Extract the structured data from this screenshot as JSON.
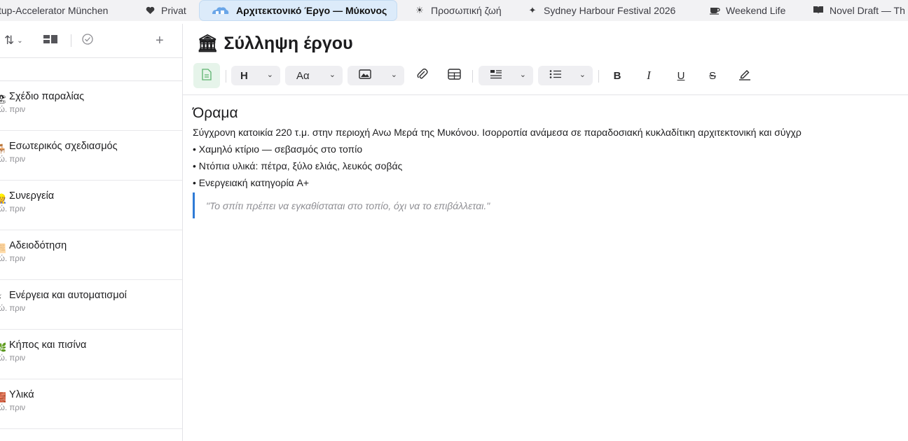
{
  "tabs": [
    {
      "icon": "",
      "label": "tup-Accelerator München",
      "active": false
    },
    {
      "icon": "heart-icon",
      "label": "Privat",
      "active": false
    },
    {
      "icon": "cloud-houses-icon",
      "label": "Αρχιτεκτονικό Έργο — Μύκονος",
      "active": true
    },
    {
      "icon": "sun-icon",
      "label": "Προσωπική ζωή",
      "active": false
    },
    {
      "icon": "sparkles-icon",
      "label": "Sydney Harbour Festival 2026",
      "active": false
    },
    {
      "icon": "coffee-icon",
      "label": "Weekend Life",
      "active": false
    },
    {
      "icon": "book-icon",
      "label": "Novel Draft — Th",
      "active": false
    }
  ],
  "sidebar": {
    "toolbar": {
      "sort_icon": "sort-icon",
      "view_icon": "view-toggle-icon",
      "check_icon": "check-circle-icon",
      "add_icon": "plus-icon"
    },
    "notes": [
      {
        "emoji": "🏖",
        "title": "Σχέδιο παραλίας",
        "time": "ώ. πριν"
      },
      {
        "emoji": "🪑",
        "title": "Εσωτερικός σχεδιασμός",
        "time": "ώ. πριν"
      },
      {
        "emoji": "👷",
        "title": "Συνεργεία",
        "time": "ώ. πριν"
      },
      {
        "emoji": "📜",
        "title": "Αδειοδότηση",
        "time": "ώ. πριν"
      },
      {
        "emoji": "⚡",
        "title": "Ενέργεια και αυτοματισμοί",
        "time": "ώ. πριν"
      },
      {
        "emoji": "🌿",
        "title": "Κήπος και πισίνα",
        "time": "ώ. πριν"
      },
      {
        "emoji": "🧱",
        "title": "Υλικά",
        "time": "ώ. πριν"
      }
    ]
  },
  "document": {
    "title_emoji": "🏛",
    "title": "Σύλληψη έργου",
    "toolbar": {
      "heading": "H",
      "font": "Aα",
      "bold": "B",
      "italic": "I",
      "underline": "U",
      "strike": "S"
    },
    "heading": "Όραμα",
    "paragraph": "Σύγχρονη κατοικία 220 τ.μ. στην περιοχή Ανω Μερά της Μυκόνου. Ισορροπία ανάμεσα σε παραδοσιακή κυκλαδίτικη αρχιτεκτονική και σύγχρ",
    "bullets": [
      "• Χαμηλό κτίριο — σεβασμός στο τοπίο",
      "• Ντόπια υλικά: πέτρα, ξύλο ελιάς, λευκός σοβάς",
      "• Ενεργειακή κατηγορία A+"
    ],
    "quote": "\"Το σπίτι πρέπει να εγκαθίσταται στο τοπίο, όχι να το επιβάλλεται.\""
  }
}
